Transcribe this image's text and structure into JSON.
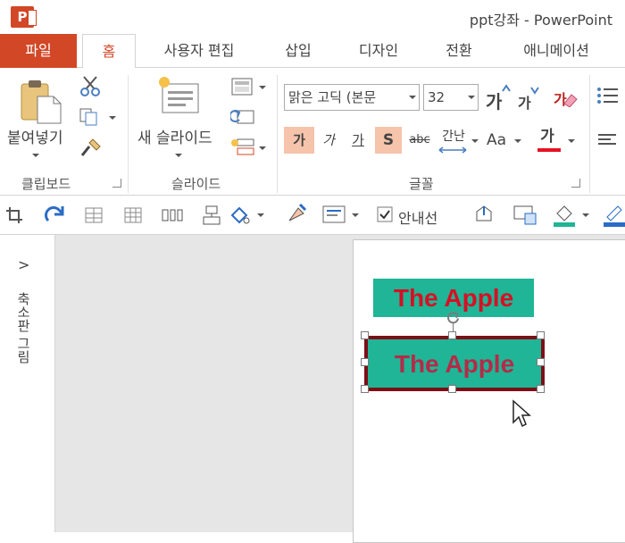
{
  "window": {
    "title": "ppt강좌 - PowerPoint",
    "app_logo": "P"
  },
  "tabs": [
    {
      "label": "파일"
    },
    {
      "label": "홈"
    },
    {
      "label": "사용자 편집"
    },
    {
      "label": "삽입"
    },
    {
      "label": "디자인"
    },
    {
      "label": "전환"
    },
    {
      "label": "애니메이션"
    }
  ],
  "ribbon": {
    "clipboard": {
      "paste_label": "붙여넣기",
      "group_label": "클립보드"
    },
    "slides": {
      "new_slide_label": "새 슬라이드",
      "group_label": "슬라이드"
    },
    "font": {
      "font_name": "맑은 고딕 (본문",
      "font_size": "32",
      "grow_label": "가",
      "shrink_label": "가",
      "bold_label": "가",
      "italic_label": "가",
      "underline_label": "가",
      "shadow_label": "S",
      "strike_label": "abc",
      "spacing_label": "간난",
      "case_label": "Aa",
      "color_label": "가",
      "clear_label": "가",
      "group_label": "글꼴"
    },
    "font_color": "#e81123",
    "accent_color": "#d24726"
  },
  "quick_access": {
    "guides_label": "안내선",
    "guides_checked": true
  },
  "thumbnail_pane": {
    "label": "축소판 그림",
    "expand_glyph": ">"
  },
  "slide": {
    "shape1": {
      "text": "The Apple",
      "fill": "#1fb596",
      "text_color": "#d80f24"
    },
    "shape2": {
      "text": "The Apple",
      "fill": "#1fb596",
      "text_color": "#b62a48",
      "outline_color": "#7d0e16"
    }
  }
}
